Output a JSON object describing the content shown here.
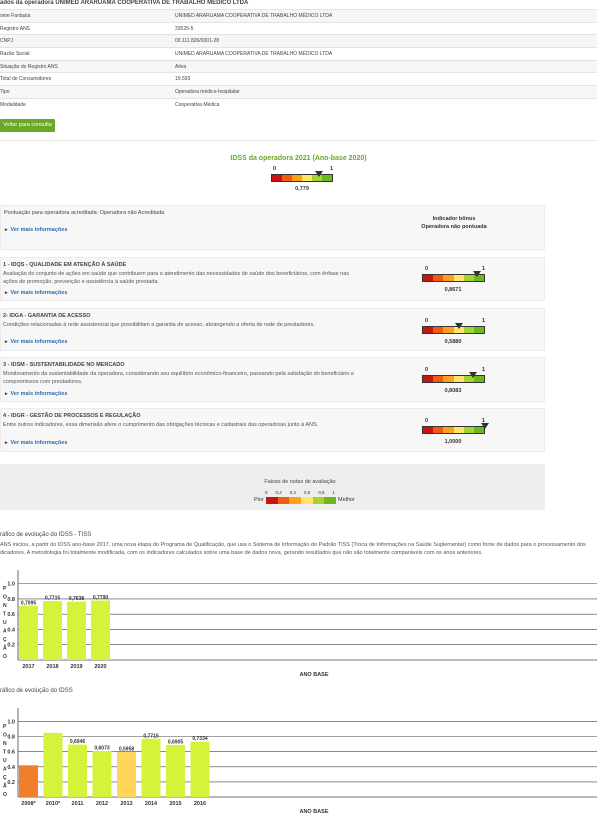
{
  "header": {
    "title": "ados da operadora UNIMED ARARUAMA COOPERATIVA DE TRABALHO MÉDICO LTDA"
  },
  "info_rows": [
    {
      "label": "ome Fantasia",
      "value": "UNIMED ARARUAMA COOPERATIVA DE TRABALHO MÉDICO LTDA"
    },
    {
      "label": "Registro ANS",
      "value": "33525-5"
    },
    {
      "label": "CNPJ",
      "value": "00.111.826/0001-28"
    },
    {
      "label": "Razão Social",
      "value": "UNIMED ARARUAMA COOPERATIVA DE TRABALHO MÉDICO LTDA"
    },
    {
      "label": "Situação do Registro ANS",
      "value": "Ativa"
    },
    {
      "label": "Total de Consumidores",
      "value": "19.593"
    },
    {
      "label": "Tipo",
      "value": "Operadora médico-hospitalar"
    },
    {
      "label": "Modalidade",
      "value": "Cooperativa Médica"
    }
  ],
  "back_button": "Voltar para consulta",
  "idss": {
    "title": "IDSS da operadora 2021 (Ano-base 2020)",
    "min": "0",
    "max": "1",
    "value": "0,779",
    "value_num": 0.779
  },
  "accredited": {
    "text": "Pontuação para operadora acreditada: Operadora não Acreditada",
    "more": "Ver mais informações",
    "bonus_label": "Indicador bônus",
    "bonus_value": "Operadora não pontuada"
  },
  "dimensions": [
    {
      "title": "1 - IDQS - QUALIDADE EM ATENÇÃO À SAÚDE",
      "desc": "Avaliação do conjunto de ações em saúde que contribuem para o atendimento das necessidades de saúde dos beneficiários, com ênfase nas ações de promoção, prevenção e assistência à saúde prestada.",
      "more": "Ver mais informações",
      "min": "0",
      "max": "1",
      "value": "0,8671",
      "value_num": 0.8671
    },
    {
      "title": "2- IDGA - GARANTIA DE ACESSO",
      "desc": "Condições relacionadas à rede assistencial que possibilitam a garantia de acesso, abrangendo a oferta de rede de prestadores.",
      "more": "Ver mais informações",
      "min": "0",
      "max": "1",
      "value": "0,5880",
      "value_num": 0.588
    },
    {
      "title": "3 - IDSM - SUSTENTABILIDADE NO MERCADO",
      "desc": "Monitoramento da sustentabilidade da operadora, considerando seu equilíbrio econômico-financeiro, passando pela satisfação do beneficiário e compromissos com prestadores.",
      "more": "Ver mais informações",
      "min": "0",
      "max": "1",
      "value": "0,8083",
      "value_num": 0.8083
    },
    {
      "title": "4 - IDGR - GESTÃO DE PROCESSOS E REGULAÇÃO",
      "desc": "Entre outros indicadores, essa dimensão afere o cumprimento das obrigações técnicas e cadastrais das operadoras junto à ANS.",
      "more": "Ver mais informações",
      "min": "0",
      "max": "1",
      "value": "1,0000",
      "value_num": 1.0
    }
  ],
  "faixas": {
    "title": "Faixas de notas de avaliação",
    "ticks": [
      "0",
      "0,2",
      "0,4",
      "0,6",
      "0,8",
      "1"
    ],
    "worse": "Pior",
    "better": "Melhor"
  },
  "colors": {
    "accent": "#6aa829",
    "link": "#2a6db0"
  },
  "chart_data": [
    {
      "type": "bar",
      "title": "ráfico de evolução do IDSS - TISS",
      "description": "ANS iniciou, a partir do IDSS ano-base 2017, uma nova etapa do Programa de Qualificação, que usa o Sistema de Informação do Padrão TISS (Troca de Informações na Saúde Suplementar) como fonte de dados para o processamento dos dicadores. A metodologia foi totalmente modificada, com os indicadores calculados sobre uma base de dados nova, gerando resultados que não são totalmente comparáveis com os anos anteriores.",
      "categories": [
        "2017",
        "2018",
        "2019",
        "2020"
      ],
      "values": [
        0.7095,
        0.7715,
        0.7638,
        0.779
      ],
      "labels": [
        "0,7095",
        "0,7715",
        "0,7638",
        "0,7790"
      ],
      "colors": [
        "#d7f23a",
        "#d7f23a",
        "#d7f23a",
        "#d7f23a"
      ],
      "ylabel": "PONTUAÇÃO",
      "xlabel": "ANO BASE",
      "yticks": [
        "1.0",
        "0.8",
        "0.6",
        "0.4",
        "0.2"
      ],
      "ylim": [
        0,
        1.1
      ]
    },
    {
      "type": "bar",
      "title": "ráfico de evolução do IDSS",
      "categories": [
        "2008*",
        "2010*",
        "2011",
        "2012",
        "2013",
        "2014",
        "2015",
        "2016"
      ],
      "values": [
        0.42,
        0.85,
        0.6946,
        0.6073,
        0.5958,
        0.7715,
        0.6905,
        0.7334
      ],
      "labels": [
        "",
        "",
        "0,6946",
        "0,6073",
        "0,5958",
        "0,7715",
        "0,6905",
        "0,7334"
      ],
      "colors": [
        "#f07e2c",
        "#d7f23a",
        "#d7f23a",
        "#d7f23a",
        "#ffd659",
        "#d7f23a",
        "#d7f23a",
        "#d7f23a"
      ],
      "ylabel": "PONTUAÇÃO",
      "xlabel": "ANO BASE",
      "yticks": [
        "1.0",
        "0.8",
        "0.6",
        "0.4",
        "0.2"
      ],
      "ylim": [
        0,
        1.1
      ]
    }
  ]
}
